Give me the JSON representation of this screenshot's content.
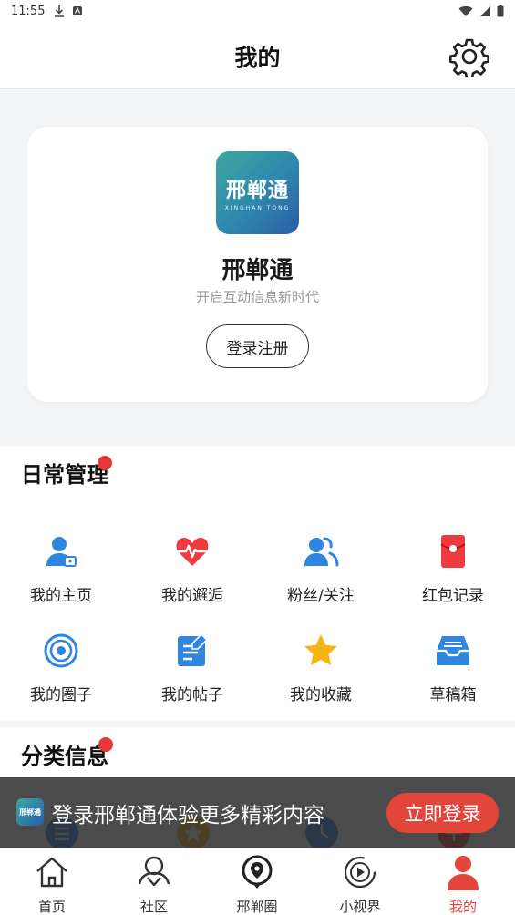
{
  "status_bar": {
    "time": "11:55"
  },
  "header": {
    "title": "我的"
  },
  "profile": {
    "logo_text": "邢郸通",
    "logo_subtext": "XINGHAN TONG",
    "app_name": "邢郸通",
    "slogan": "开启互动信息新时代",
    "login_label": "登录注册"
  },
  "daily": {
    "title": "日常管理",
    "items": [
      {
        "label": "我的主页",
        "icon": "user-home-icon"
      },
      {
        "label": "我的邂逅",
        "icon": "heart-pulse-icon"
      },
      {
        "label": "粉丝/关注",
        "icon": "followers-icon"
      },
      {
        "label": "红包记录",
        "icon": "red-envelope-icon"
      },
      {
        "label": "我的圈子",
        "icon": "circle-target-icon"
      },
      {
        "label": "我的帖子",
        "icon": "post-edit-icon"
      },
      {
        "label": "我的收藏",
        "icon": "star-icon"
      },
      {
        "label": "草稿箱",
        "icon": "inbox-icon"
      }
    ]
  },
  "category": {
    "title": "分类信息"
  },
  "banner": {
    "text": "登录邢郸通体验更多精彩内容",
    "button_label": "立即登录",
    "logo_text": "邢郸通"
  },
  "tabs": [
    {
      "label": "首页",
      "icon": "home-icon"
    },
    {
      "label": "社区",
      "icon": "community-icon"
    },
    {
      "label": "邢郸圈",
      "icon": "location-circle-icon"
    },
    {
      "label": "小视界",
      "icon": "play-circle-icon"
    },
    {
      "label": "我的",
      "icon": "person-icon"
    }
  ],
  "colors": {
    "accent": "#e2453a",
    "badge": "#e53935",
    "icon_blue": "#2f86e0",
    "logo_start": "#3da7a0",
    "logo_end": "#2a5ea8"
  }
}
